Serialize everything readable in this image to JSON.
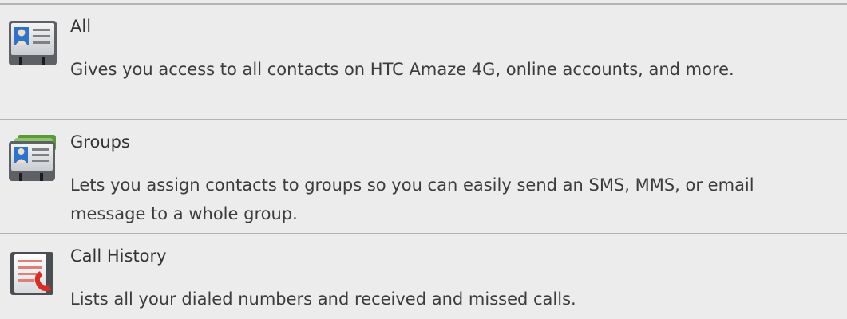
{
  "entries": [
    {
      "icon": "contact-card-icon",
      "title": "All",
      "description": "Gives you access to all contacts on HTC Amaze 4G, online accounts, and more."
    },
    {
      "icon": "group-cards-icon",
      "title": "Groups",
      "description": "Lets you assign contacts to groups so you can easily send an SMS, MMS, or email message to a whole group."
    },
    {
      "icon": "call-history-icon",
      "title": "Call History",
      "description": "Lists all your dialed numbers and received and missed calls."
    }
  ]
}
